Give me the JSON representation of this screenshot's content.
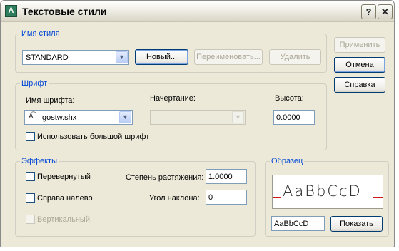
{
  "window": {
    "title": "Текстовые стили",
    "icon_glyph": "A",
    "help_glyph": "?",
    "close_glyph": "✕"
  },
  "style_group": {
    "label": "Имя стиля",
    "selected_style": "STANDARD",
    "new_button": "Новый...",
    "rename_button": "Переименовать...",
    "delete_button": "Удалить"
  },
  "side_buttons": {
    "apply": "Применить",
    "cancel": "Отмена",
    "help": "Справка"
  },
  "font_group": {
    "label": "Шрифт",
    "font_name_label": "Имя шрифта:",
    "font_name_value": "gostw.shx",
    "style_label": "Начертание:",
    "style_value": "",
    "height_label": "Высота:",
    "height_value": "0.0000",
    "bigfont_label": "Использовать большой шрифт",
    "bigfont_checked": false
  },
  "effects_group": {
    "label": "Эффекты",
    "upside_down_label": "Перевернутый",
    "upside_down_checked": false,
    "backwards_label": "Справа налево",
    "backwards_checked": false,
    "vertical_label": "Вертикальный",
    "vertical_enabled": false,
    "width_factor_label": "Степень растяжения:",
    "width_factor_value": "1.0000",
    "oblique_label": "Угол наклона:",
    "oblique_value": "0"
  },
  "preview_group": {
    "label": "Образец",
    "preview_text": "AaBbCcD",
    "sample_input": "AaBbCcD",
    "show_button": "Показать"
  },
  "colors": {
    "dialog_bg": "#ece9d8",
    "group_label": "#0046d5",
    "preview_line": "#d01818"
  }
}
